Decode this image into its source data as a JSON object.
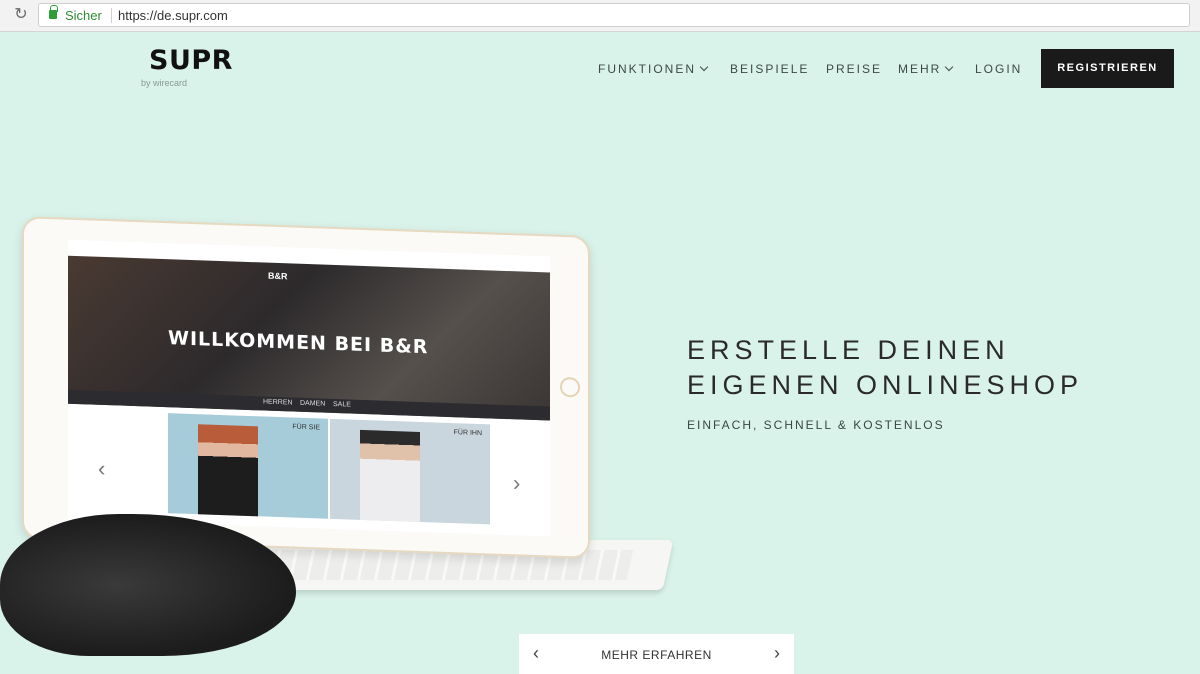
{
  "browser": {
    "reload_icon": "reload-icon",
    "secure_label": "Sicher",
    "url": "https://de.supr.com"
  },
  "header": {
    "logo": "SUPR",
    "logo_sub": "by wirecard",
    "nav": [
      {
        "label": "FUNKTIONEN",
        "dropdown": true
      },
      {
        "label": "BEISPIELE",
        "dropdown": false
      },
      {
        "label": "PREISE",
        "dropdown": false
      },
      {
        "label": "MEHR",
        "dropdown": true
      },
      {
        "label": "LOGIN",
        "dropdown": false
      }
    ],
    "cta": "REGISTRIEREN"
  },
  "hero": {
    "headline_line1": "ERSTELLE DEINEN",
    "headline_line2": "EIGENEN ONLINESHOP",
    "subline": "EINFACH, SCHNELL & KOSTENLOS"
  },
  "tablet_screen": {
    "brand": "B&R",
    "title": "WILLKOMMEN BEI B&R",
    "nav": [
      "HERREN",
      "DAMEN",
      "SALE"
    ],
    "tiles": [
      "FÜR SIE",
      "FÜR IHN"
    ]
  },
  "pager": {
    "label": "MEHR ERFAHREN"
  },
  "colors": {
    "background": "#d9f2ea",
    "cta_bg": "#1a1a1a",
    "secure_green": "#2e8b36"
  }
}
